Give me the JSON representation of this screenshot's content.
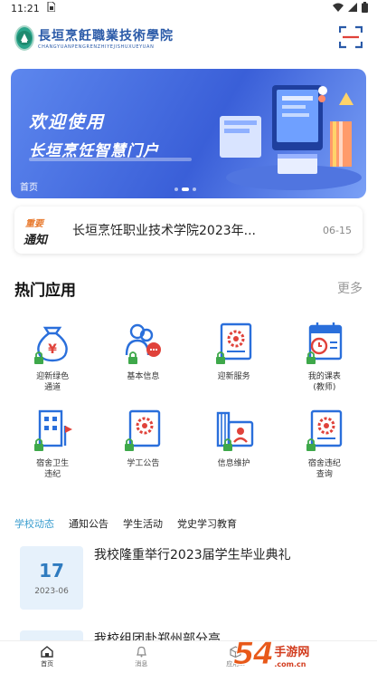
{
  "status_bar": {
    "time": "11:21",
    "icons": [
      "sim-card-icon",
      "wifi-icon",
      "cellular-icon",
      "battery-icon"
    ]
  },
  "header": {
    "logo_cn": "長垣烹飪職業技術學院",
    "logo_en": "CHANGYUANPENGRENZHIYEJISHUXUEYUAN",
    "scan_icon": "scan-icon"
  },
  "banner": {
    "line1": "欢迎使用",
    "line2": "长垣烹饪智慧门户",
    "label": "首页",
    "slide_count": 3,
    "active_slide": 2
  },
  "notice": {
    "badge_top": "重要",
    "badge_bottom": "通知",
    "text": "长垣烹饪职业技术学院2023年...",
    "date": "06-15"
  },
  "hot_apps": {
    "title": "热门应用",
    "more": "更多",
    "items": [
      {
        "label": "迎新绿色\n通道",
        "icon": "money-bag-icon"
      },
      {
        "label": "基本信息",
        "icon": "people-icon"
      },
      {
        "label": "迎新服务",
        "icon": "certificate-icon"
      },
      {
        "label": "我的课表\n(教师)",
        "icon": "calendar-clock-icon"
      },
      {
        "label": "宿舍卫生\n违纪",
        "icon": "building-flag-icon"
      },
      {
        "label": "学工公告",
        "icon": "award-document-icon"
      },
      {
        "label": "信息维护",
        "icon": "id-card-building-icon"
      },
      {
        "label": "宿舍违纪\n查询",
        "icon": "settings-document-icon"
      }
    ]
  },
  "tabs": [
    {
      "label": "学校动态",
      "active": true
    },
    {
      "label": "通知公告",
      "active": false
    },
    {
      "label": "学生活动",
      "active": false
    },
    {
      "label": "党史学习教育",
      "active": false
    }
  ],
  "news": [
    {
      "day": "17",
      "month": "2023-06",
      "title": "我校隆重举行2023届学生毕业典礼"
    },
    {
      "title": "我校组团赴郑州部分高..."
    }
  ],
  "bottom_nav": [
    {
      "label": "首页",
      "icon": "home-icon",
      "active": true
    },
    {
      "label": "消息",
      "icon": "bell-icon",
      "active": false
    },
    {
      "label": "应用...",
      "icon": "cube-icon",
      "active": false
    }
  ],
  "watermark": {
    "main": "54",
    "cn": "手游网",
    "url": ".com.cn"
  },
  "colors": {
    "accent": "#3b9ecf",
    "banner": "#4a72e2",
    "icon_blue": "#2a6fdb",
    "icon_red": "#e0423a",
    "icon_green": "#3ea84a",
    "notice_orange": "#e8792d"
  }
}
